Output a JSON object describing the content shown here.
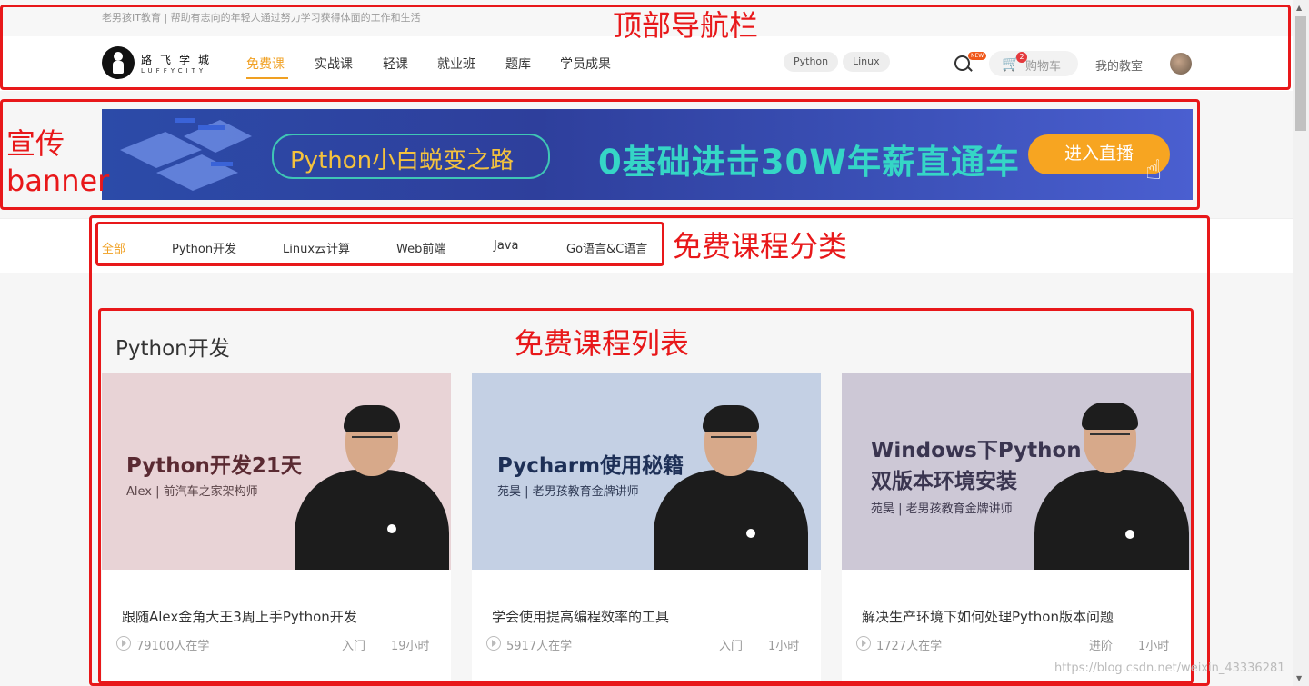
{
  "top_bar": {
    "slogan": "老男孩IT教育 | 帮助有志向的年轻人通过努力学习获得体面的工作和生活"
  },
  "logo": {
    "text_cn": "路飞学城",
    "text_en": "LUFFYCITY"
  },
  "nav": {
    "items": [
      {
        "label": "免费课",
        "active": true
      },
      {
        "label": "实战课"
      },
      {
        "label": "轻课"
      },
      {
        "label": "就业班"
      },
      {
        "label": "题库"
      },
      {
        "label": "学员成果"
      }
    ],
    "accent": "#f0a022"
  },
  "search": {
    "tags": [
      "Python",
      "Linux"
    ],
    "new_badge": "NEW"
  },
  "cart": {
    "label": "购物车",
    "count": "2"
  },
  "classroom_label": "我的教室",
  "banner": {
    "pill_text": "Python小白蜕变之路",
    "headline": "0基础进击30W年薪直通车",
    "cta": "进入直播"
  },
  "categories": {
    "items": [
      {
        "label": "全部",
        "active": true
      },
      {
        "label": "Python开发"
      },
      {
        "label": "Linux云计算"
      },
      {
        "label": "Web前端"
      },
      {
        "label": "Java"
      },
      {
        "label": "Go语言&C语言"
      }
    ]
  },
  "section": {
    "title": "Python开发"
  },
  "courses": [
    {
      "cover_title": "Python开发21天",
      "cover_subtitle": "Alex | 前汽车之家架构师",
      "name": "跟随Alex金角大王3周上手Python开发",
      "students": "79100人在学",
      "level": "入门",
      "hours": "19小时",
      "cover_color": "#e8d3d6"
    },
    {
      "cover_title": "Pycharm使用秘籍",
      "cover_subtitle": "苑昊 | 老男孩教育金牌讲师",
      "name": "学会使用提高编程效率的工具",
      "students": "5917人在学",
      "level": "入门",
      "hours": "1小时",
      "cover_color": "#c4d0e4"
    },
    {
      "cover_title_1": "Windows下Python",
      "cover_title_2": "双版本环境安装",
      "cover_subtitle": "苑昊 | 老男孩教育金牌讲师",
      "name": "解决生产环境下如何处理Python版本问题",
      "students": "1727人在学",
      "level": "进阶",
      "hours": "1小时",
      "cover_color": "#cdc8d6"
    }
  ],
  "annotations": {
    "top_nav": "顶部导航栏",
    "banner_line1": "宣传",
    "banner_line2": "banner",
    "category": "免费课程分类",
    "course_list": "免费课程列表",
    "color": "#e8181a"
  },
  "watermark": "https://blog.csdn.net/weixin_43336281"
}
